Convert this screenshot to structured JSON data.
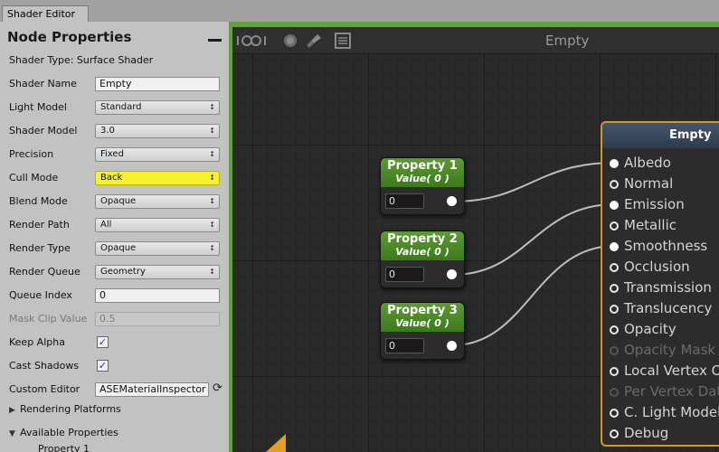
{
  "window": {
    "tab_title": "Shader Editor"
  },
  "panel": {
    "title": "Node Properties",
    "shader_type": "Shader Type: Surface Shader",
    "rows": [
      {
        "label": "Shader Name",
        "kind": "text",
        "value": "Empty"
      },
      {
        "label": "Light Model",
        "kind": "dropdown",
        "value": "Standard"
      },
      {
        "label": "Shader Model",
        "kind": "dropdown",
        "value": "3.0"
      },
      {
        "label": "Precision",
        "kind": "dropdown",
        "value": "Fixed"
      },
      {
        "label": "Cull Mode",
        "kind": "dropdown",
        "value": "Back",
        "highlight": true
      },
      {
        "label": "Blend Mode",
        "kind": "dropdown",
        "value": "Opaque"
      },
      {
        "label": "Render Path",
        "kind": "dropdown",
        "value": "All"
      },
      {
        "label": "Render Type",
        "kind": "dropdown",
        "value": "Opaque"
      },
      {
        "label": "Render Queue",
        "kind": "dropdown",
        "value": "Geometry"
      },
      {
        "label": "Queue Index",
        "kind": "text",
        "value": "0"
      },
      {
        "label": "Mask Clip Value",
        "kind": "text",
        "value": "0.5",
        "disabled": true
      },
      {
        "label": "Keep Alpha",
        "kind": "checkbox",
        "checked": true
      },
      {
        "label": "Cast Shadows",
        "kind": "checkbox",
        "checked": true
      },
      {
        "label": "Custom Editor",
        "kind": "custom",
        "value": "ASEMaterialInspector"
      }
    ],
    "rendering_platforms": "Rendering Platforms",
    "available_properties": "Available Properties",
    "property_item": "Property 1"
  },
  "canvas": {
    "title": "Empty",
    "accent_color": "#5fa33b",
    "nodes": [
      {
        "title": "Property 1",
        "subtitle": "Value( 0 )",
        "value": "0"
      },
      {
        "title": "Property 2",
        "subtitle": "Value( 0 )",
        "value": "0"
      },
      {
        "title": "Property 3",
        "subtitle": "Value( 0 )",
        "value": "0"
      }
    ],
    "output": {
      "title": "Empty",
      "border_color": "#d39a1e",
      "inputs": [
        {
          "label": "Albedo",
          "state": "connected"
        },
        {
          "label": "Normal",
          "state": "open"
        },
        {
          "label": "Emission",
          "state": "connected"
        },
        {
          "label": "Metallic",
          "state": "open"
        },
        {
          "label": "Smoothness",
          "state": "connected"
        },
        {
          "label": "Occlusion",
          "state": "open"
        },
        {
          "label": "Transmission",
          "state": "open"
        },
        {
          "label": "Translucency",
          "state": "open"
        },
        {
          "label": "Opacity",
          "state": "open"
        },
        {
          "label": "Opacity Mask",
          "state": "disabled"
        },
        {
          "label": "Local Vertex O",
          "state": "open"
        },
        {
          "label": "Per Vertex Dat",
          "state": "disabled"
        },
        {
          "label": "C. Light Model",
          "state": "open"
        },
        {
          "label": "Debug",
          "state": "open"
        }
      ]
    }
  }
}
